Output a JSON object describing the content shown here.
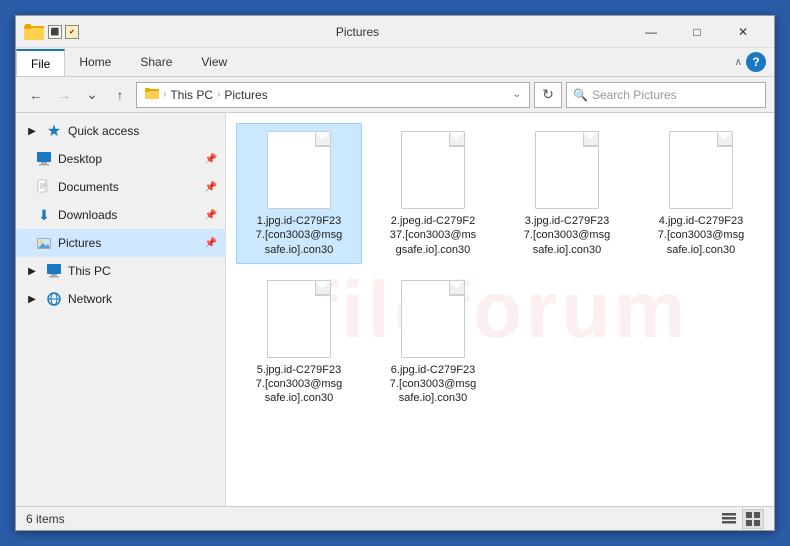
{
  "window": {
    "title": "Pictures",
    "title_icon": "📁"
  },
  "ribbon": {
    "tabs": [
      "File",
      "Home",
      "Share",
      "View"
    ],
    "active_tab": "File",
    "help_label": "?"
  },
  "address_bar": {
    "back_label": "←",
    "forward_label": "→",
    "recent_label": "∨",
    "up_label": "↑",
    "path_parts": [
      "This PC",
      "Pictures"
    ],
    "refresh_label": "⟳",
    "search_placeholder": "Search Pictures"
  },
  "sidebar": {
    "sections": [
      {
        "label": "Quick access",
        "icon": "★",
        "pinned": false,
        "children": [
          {
            "label": "Desktop",
            "icon": "🖥",
            "pinned": true
          },
          {
            "label": "Documents",
            "icon": "📄",
            "pinned": true
          },
          {
            "label": "Downloads",
            "icon": "⬇",
            "pinned": true
          },
          {
            "label": "Pictures",
            "icon": "🖼",
            "pinned": true,
            "active": true
          }
        ]
      },
      {
        "label": "This PC",
        "icon": "💻",
        "pinned": false,
        "children": []
      },
      {
        "label": "Network",
        "icon": "🌐",
        "pinned": false,
        "children": []
      }
    ]
  },
  "files": [
    {
      "name": "1.jpg.id-C279F23\n7.[con3003@msg\nsafe.io].con30",
      "selected": true
    },
    {
      "name": "2.jpeg.id-C279F2\n37.[con3003@ms\ngsafe.io].con30",
      "selected": false
    },
    {
      "name": "3.jpg.id-C279F23\n7.[con3003@msg\nsafe.io].con30",
      "selected": false
    },
    {
      "name": "4.jpg.id-C279F23\n7.[con3003@msg\nsafe.io].con30",
      "selected": false
    },
    {
      "name": "5.jpg.id-C279F23\n7.[con3003@msg\nsafe.io].con30",
      "selected": false
    },
    {
      "name": "6.jpg.id-C279F23\n7.[con3003@msg\nsafe.io].con30",
      "selected": false
    }
  ],
  "status": {
    "item_count": "6 items"
  },
  "title_controls": {
    "minimize": "—",
    "maximize": "□",
    "close": "✕"
  }
}
